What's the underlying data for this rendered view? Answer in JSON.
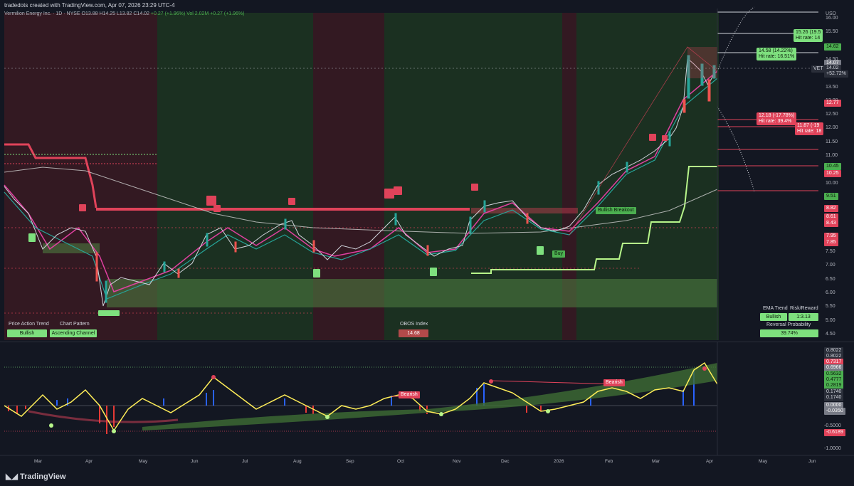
{
  "header": {
    "created": "tradedots created with TradingView.com, Apr 07, 2026 23:29 UTC-4",
    "symbol": "Vermilion Energy Inc. · 1D · NYSE",
    "o": "O13.88",
    "h": "H14.25",
    "l": "L13.82",
    "c": "C14.02",
    "chg": "+0.27 (+1.96%)",
    "vol": "Vol 2.02M",
    "vol_chg": "+0.27 (+1.96%)"
  },
  "price_axis": {
    "currency": "USD",
    "ticks": [
      "16.00",
      "15.50",
      "15.00",
      "14.50",
      "14.00",
      "13.50",
      "13.00",
      "12.50",
      "12.00",
      "11.50",
      "11.00",
      "10.50",
      "10.00",
      "9.50",
      "9.00",
      "8.50",
      "8.00",
      "7.50",
      "7.00",
      "6.50",
      "6.00",
      "5.50",
      "5.00",
      "4.50"
    ],
    "tags": {
      "t1": "14.62",
      "t2": "14.07",
      "t3": "14.02",
      "t4": "+52.72%",
      "t5": "12.77",
      "t6": "10.45",
      "t7": "10.25",
      "t8": "9.51",
      "t9": "8.82",
      "t10": "8.61",
      "t11": "8.43",
      "t12": "7.95",
      "t13": "7.85",
      "vet": "VET"
    }
  },
  "targets": {
    "up1_a": "15.26 (19.5",
    "up1_b": "Hit rate: 14",
    "up2_a": "14.58 (14.22%)",
    "up2_b": "Hit rate: 16.51%",
    "dn1_a": "12.18 (-17.78%)",
    "dn1_b": "Hit rate: 39.4%",
    "dn2_a": "11.87 (-19",
    "dn2_b": "Hit rate: 18"
  },
  "annotations": {
    "bullish_breakout": "Bullish Breakout",
    "buy": "Buy",
    "bearish1": "Bearish",
    "bearish2": "Bearish"
  },
  "bottom_panels": {
    "price_action_trend": "Price Action Trend",
    "chart_pattern": "Chart Pattern",
    "trend_value": "Bullish",
    "pattern_value": "Ascending Channel",
    "obos_label": "OBOS Index",
    "obos_value": "14.68",
    "ema_trend": "EMA Trend",
    "risk_reward": "Risk/Reward",
    "ema_value": "Bullish",
    "rr_value": "1:3.13",
    "reversal_label": "Reversal Probability",
    "reversal_value": "39.74%"
  },
  "osc_axis": {
    "ticks": [
      "0.8022",
      "0.8022",
      "0.7317",
      "0.6966",
      "0.5632",
      "0.4777",
      "0.2819",
      "0.1740",
      "0.1740",
      "0.0000",
      "-0.0350",
      "-0.5000",
      "-0.6189",
      "-1.0000"
    ]
  },
  "time_axis": [
    "Mar",
    "Apr",
    "May",
    "Jun",
    "Jul",
    "Aug",
    "Sep",
    "Oct",
    "Nov",
    "Dec",
    "2026",
    "Feb",
    "Mar",
    "Apr",
    "May",
    "Jun"
  ],
  "brand": "TradingView",
  "colors": {
    "bg": "#131722",
    "bull": "#4caf50",
    "bear": "#e0435a",
    "accent_green": "#7ee07e"
  }
}
